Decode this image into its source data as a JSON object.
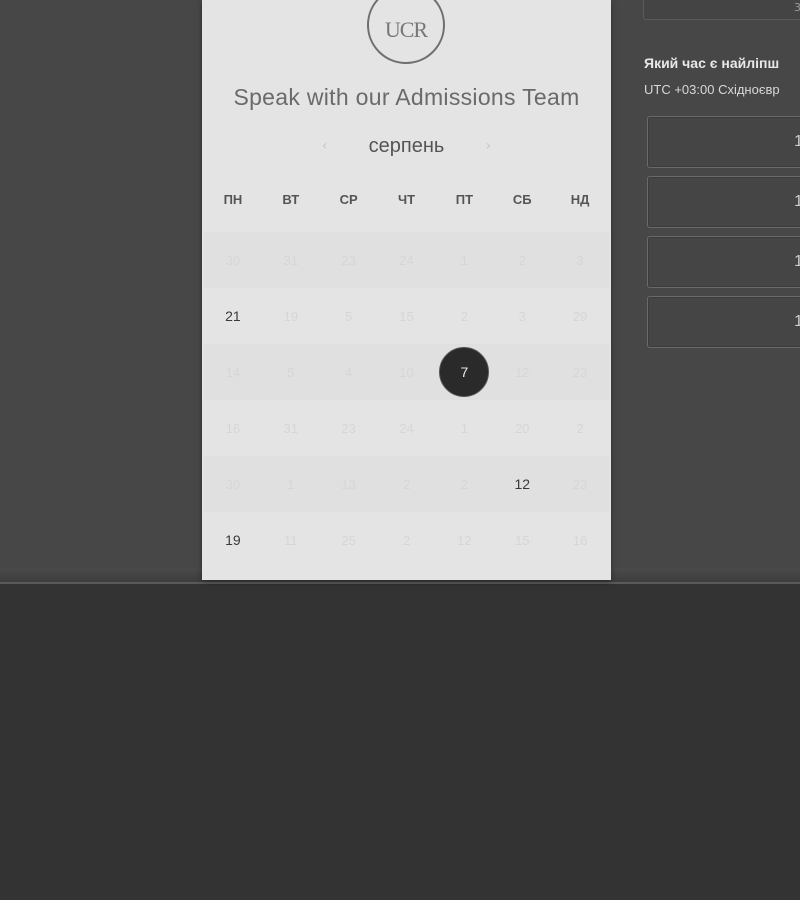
{
  "card": {
    "logo_text": "UCR",
    "title": "Speak with our Admissions Team",
    "month": "серпень",
    "prev_icon": "chevron-left-icon",
    "next_icon": "chevron-right-icon",
    "weekdays": [
      "ПН",
      "ВТ",
      "СР",
      "ЧТ",
      "ПТ",
      "СБ",
      "НД"
    ],
    "weeks": [
      [
        "30",
        "31",
        "23",
        "24",
        "1",
        "2",
        "3"
      ],
      [
        "21",
        "19",
        "5",
        "15",
        "2",
        "3",
        "29"
      ],
      [
        "14",
        "5",
        "4",
        "10",
        "7",
        "12",
        "23"
      ],
      [
        "16",
        "31",
        "23",
        "24",
        "1",
        "20",
        "2"
      ],
      [
        "30",
        "1",
        "13",
        "2",
        "2",
        "12",
        "23"
      ],
      [
        "19",
        "11",
        "25",
        "2",
        "12",
        "15",
        "16"
      ]
    ],
    "available_days": [
      "21",
      "7",
      "12",
      "19"
    ],
    "selected_day": "7"
  },
  "right_panel": {
    "top_field_value": "30",
    "question": "Який час є найліпш",
    "timezone": "UTC +03:00 Східноєвр",
    "slots": [
      "1",
      "1",
      "1",
      "1"
    ]
  },
  "colors": {
    "backdrop": "#474747",
    "card_bg": "#e4e4e4",
    "selected_day_bg": "#2a2a2a"
  }
}
